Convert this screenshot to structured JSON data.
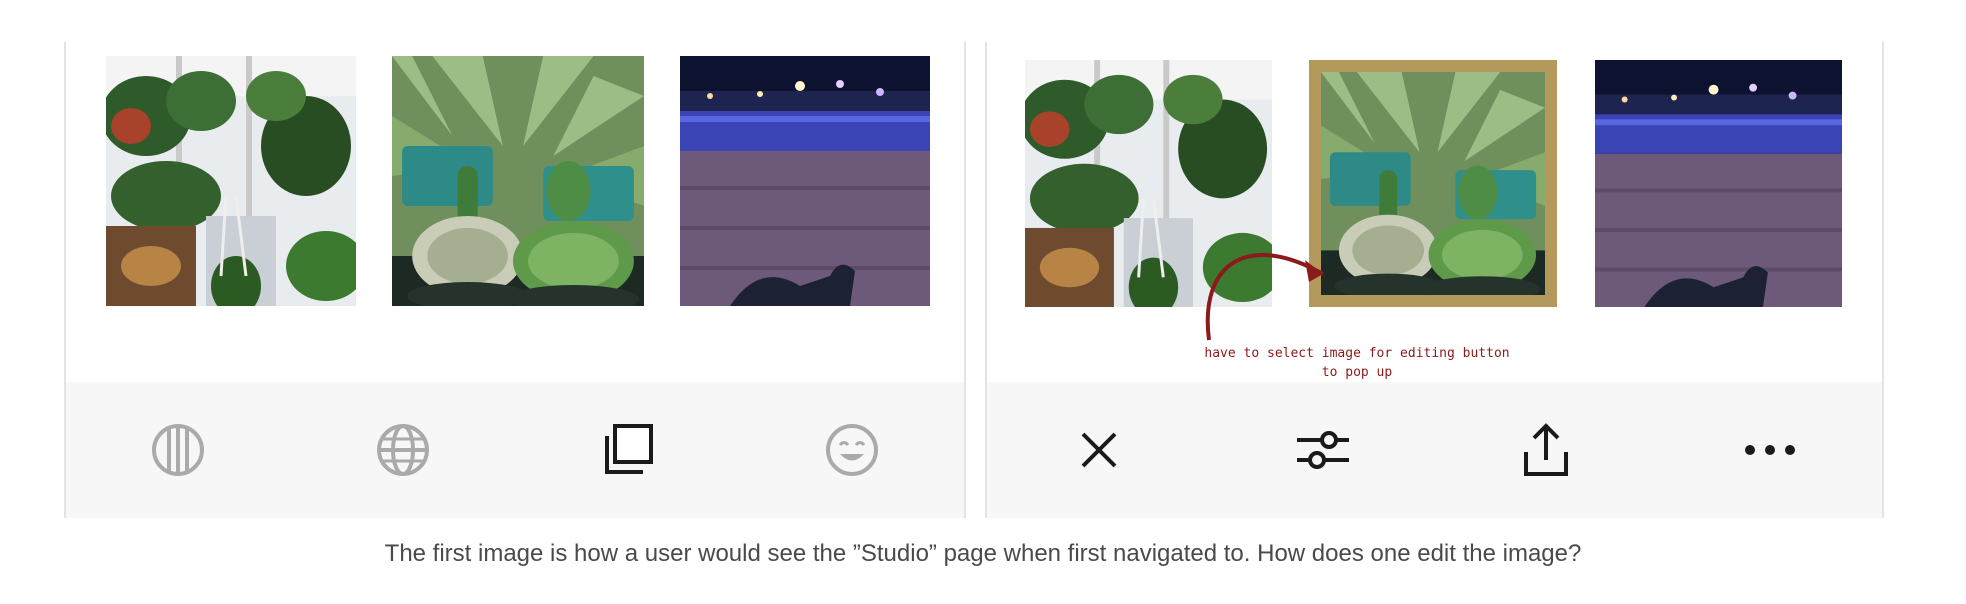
{
  "left_panel": {
    "images": [
      {
        "subject": "hanging plants greenhouse"
      },
      {
        "subject": "potted cacti and succulents"
      },
      {
        "subject": "night pool deck"
      }
    ],
    "toolbar": [
      {
        "icon": "columns-circle-icon"
      },
      {
        "icon": "globe-icon"
      },
      {
        "icon": "stacked-squares-icon"
      },
      {
        "icon": "smiley-face-icon"
      }
    ]
  },
  "right_panel": {
    "selected_index": 1,
    "annotation": {
      "line1": "have to select image for editing button",
      "line2": "to pop up"
    },
    "toolbar": [
      {
        "icon": "close-icon"
      },
      {
        "icon": "adjust-sliders-icon"
      },
      {
        "icon": "share-upload-icon"
      },
      {
        "icon": "more-dots-icon"
      }
    ]
  },
  "caption": "The first image is how a user would see the ”Studio” page when first navigated to. How does one edit the image?",
  "colors": {
    "selection_frame": "#b39a5c",
    "annotation_red": "#8b1a1a",
    "toolbar_bg": "#f7f7f7",
    "inactive_icon": "#aaaaaa",
    "active_icon": "#1a1a1a"
  }
}
